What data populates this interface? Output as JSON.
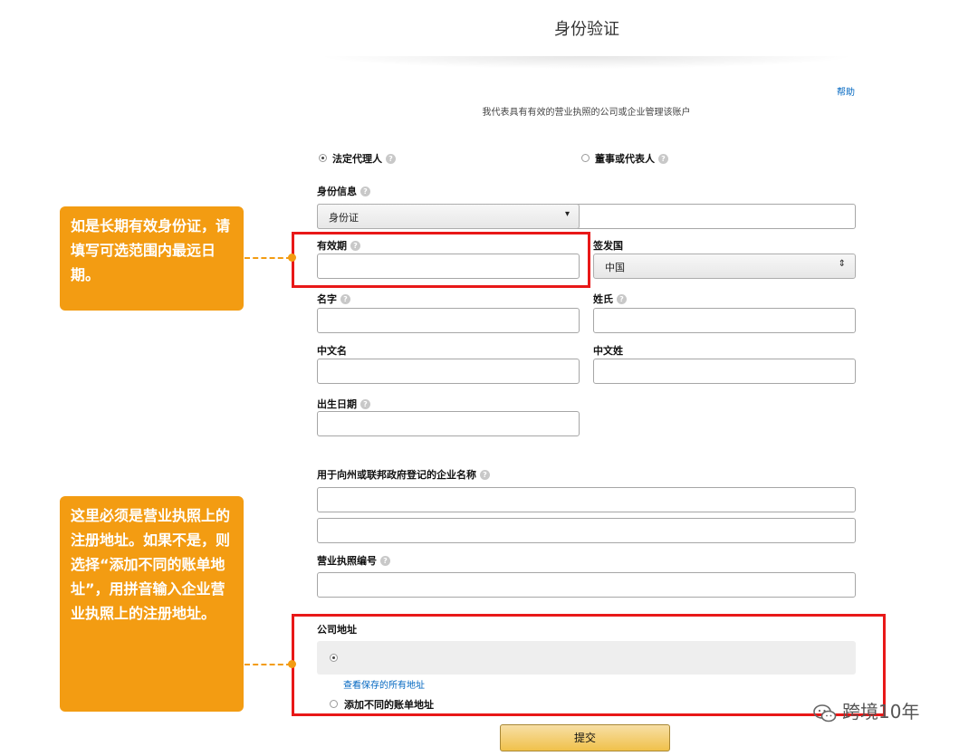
{
  "page": {
    "title": "身份验证",
    "help_link": "帮助",
    "subtitle": "我代表具有有效的营业执照的公司或企业管理该账户"
  },
  "role": {
    "option_legal": "法定代理人",
    "option_director": "董事或代表人"
  },
  "identity": {
    "label": "身份信息",
    "type_value": "身份证",
    "expiry_label": "有效期",
    "expiry_value": "",
    "issuing_country_label": "签发国",
    "issuing_country_value": "中国"
  },
  "name": {
    "first_label": "名字",
    "last_label": "姓氏",
    "cn_first_label": "中文名",
    "cn_last_label": "中文姓",
    "birth_label": "出生日期"
  },
  "business": {
    "name_label": "用于向州或联邦政府登记的企业名称",
    "license_label": "营业执照编号"
  },
  "address": {
    "label": "公司地址",
    "view_saved_link": "查看保存的所有地址",
    "add_different": "添加不同的账单地址"
  },
  "submit_label": "提交",
  "annotations": {
    "note1": "如是长期有效身份证，请填写可选范围内最远日期。",
    "note2": "这里必须是营业执照上的注册地址。如果不是，则选择“添加不同的账单地址”，用拼音输入企业营业执照上的注册地址。"
  },
  "watermark": "跨境10年",
  "colors": {
    "annotation": "#f39c12",
    "highlight": "#e81818",
    "link": "#0066c0",
    "button": "#f0c14b"
  },
  "icons": {
    "help": "question-circle-icon",
    "dropdown": "chevron-down-icon",
    "watermark": "wechat-icon"
  }
}
